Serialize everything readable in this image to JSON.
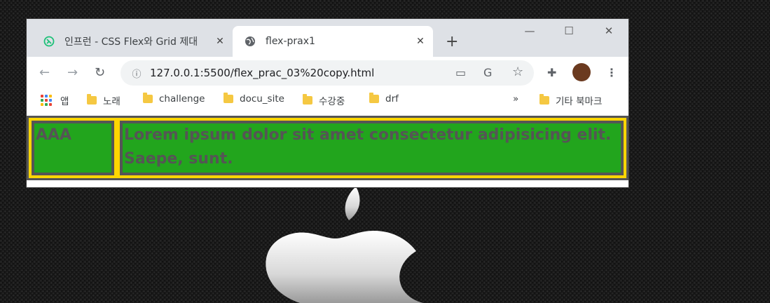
{
  "browser": {
    "tabs": [
      {
        "title": "인프런 - CSS Flex와 Grid 제대",
        "close": "✕",
        "active": false
      },
      {
        "title": "flex-prax1",
        "close": "✕",
        "active": true
      }
    ],
    "new_tab": "+",
    "window_controls": {
      "minimize": "—",
      "maximize": "☐",
      "close": "✕"
    },
    "address": "127.0.0.1:5500/flex_prac_03%20copy.html",
    "bookmarks": [
      {
        "label": "앱",
        "type": "apps"
      },
      {
        "label": "노래",
        "type": "folder"
      },
      {
        "label": "challenge",
        "type": "folder"
      },
      {
        "label": "docu_site",
        "type": "folder"
      },
      {
        "label": "수강중",
        "type": "folder"
      },
      {
        "label": "drf",
        "type": "folder"
      }
    ],
    "more_bookmarks": "»",
    "other_bookmarks": "기타 북마크"
  },
  "page": {
    "item1": "AAA",
    "item2": "Lorem ipsum dolor sit amet consectetur adipisicing elit. Saepe, sunt."
  },
  "colors": {
    "container_bg": "#ffd600",
    "item_bg": "#22a51d",
    "border": "#555555"
  }
}
